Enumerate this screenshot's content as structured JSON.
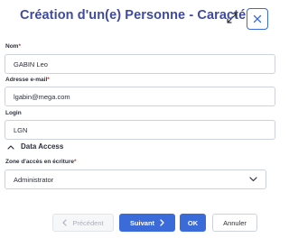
{
  "dialog": {
    "title": "Création d'un(e) Personne - Caracté..."
  },
  "icons": {
    "expand": "expand-arrows-icon",
    "close": "close-icon",
    "section_toggle": "chevron-up-icon",
    "select_toggle": "chevron-down-icon",
    "prev": "chevron-left-icon",
    "next": "chevron-right-icon"
  },
  "fields": {
    "nom": {
      "label": "Nom",
      "value": "GABIN Leo",
      "required": "*"
    },
    "email": {
      "label": "Adresse e-mail",
      "value": "lgabin@mega.com",
      "required": "*"
    },
    "login": {
      "label": "Login",
      "value": "LGN"
    }
  },
  "data_access": {
    "section_title": "Data Access",
    "zone_label": "Zone d'accès en écriture",
    "zone_required": "*",
    "zone_value": "Administrator"
  },
  "footer": {
    "prev_label": "Précédent",
    "next_label": "Suivant",
    "ok_label": "OK",
    "cancel_label": "Annuler"
  },
  "colors": {
    "title": "#3f4a9e",
    "primary": "#3b6ad9",
    "required": "#d0362a",
    "border": "#cdd2dc"
  }
}
